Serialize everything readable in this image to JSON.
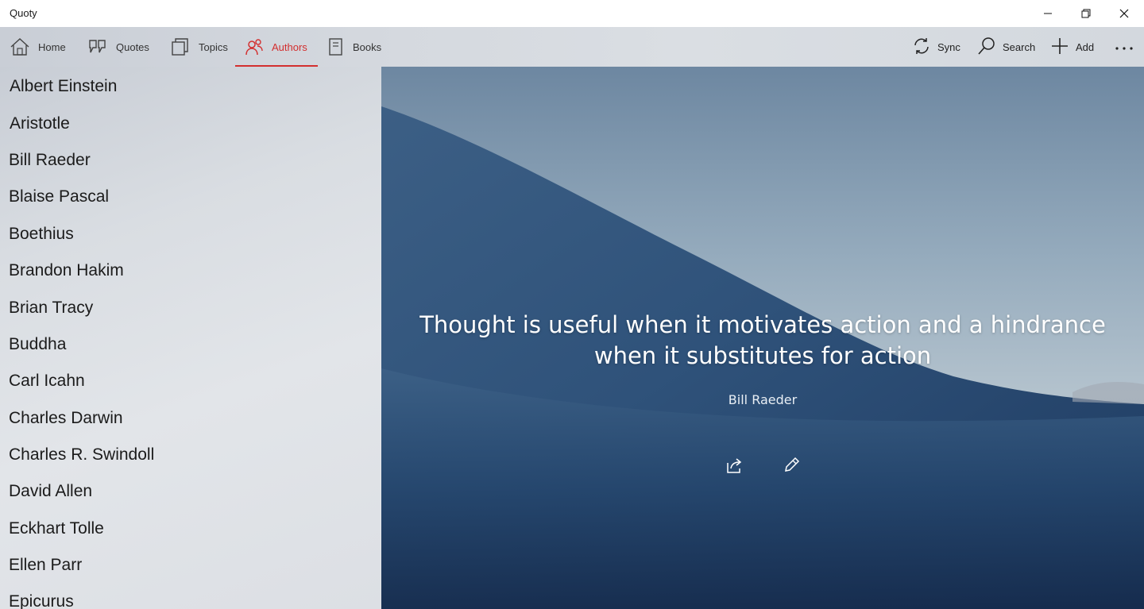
{
  "window": {
    "title": "Quoty"
  },
  "nav": {
    "tabs": [
      {
        "label": "Home",
        "icon": "home-icon"
      },
      {
        "label": "Quotes",
        "icon": "quote-icon"
      },
      {
        "label": "Topics",
        "icon": "topics-icon"
      },
      {
        "label": "Authors",
        "icon": "authors-icon",
        "active": true
      },
      {
        "label": "Books",
        "icon": "book-icon"
      }
    ],
    "commands": [
      {
        "label": "Sync",
        "icon": "sync-icon"
      },
      {
        "label": "Search",
        "icon": "search-icon"
      },
      {
        "label": "Add",
        "icon": "add-icon"
      }
    ],
    "more_icon": "more-icon"
  },
  "authors": [
    "Albert Einstein",
    "Aristotle",
    "Bill Raeder",
    "Blaise Pascal",
    "Boethius",
    "Brandon Hakim",
    "Brian Tracy",
    "Buddha",
    "Carl Icahn",
    "Charles Darwin",
    "Charles R. Swindoll",
    "David Allen",
    "Eckhart Tolle",
    "Ellen Parr",
    "Epicurus"
  ],
  "quote": {
    "text": "Thought is useful when it motivates action and a hindrance when it substitutes for action",
    "author": "Bill Raeder"
  },
  "colors": {
    "accent": "#d32f2f"
  }
}
